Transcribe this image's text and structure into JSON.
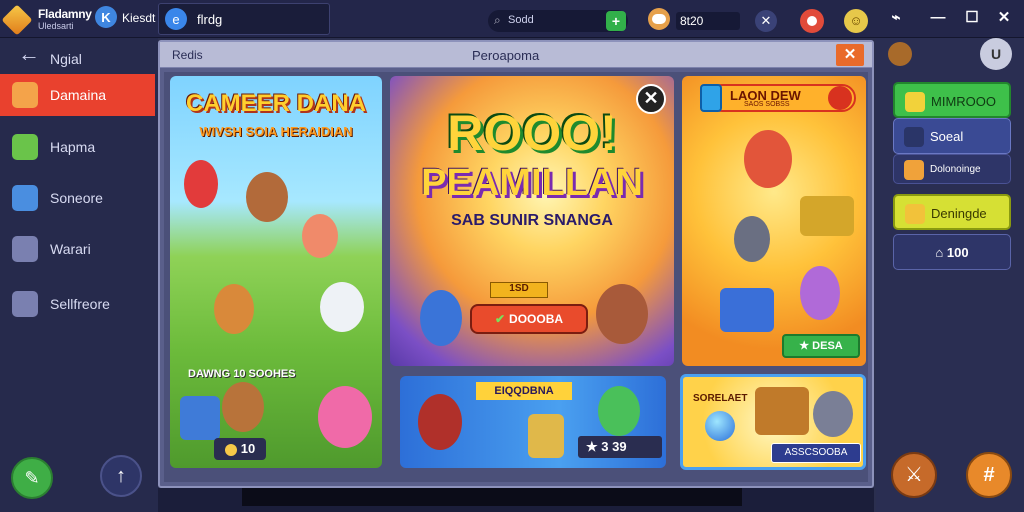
{
  "topbar": {
    "brand_title": "Fladamny",
    "brand_sub": "Uledsarti",
    "brand2_letter": "K",
    "brand2_text": "Kiesdt",
    "search_value": "flrdg",
    "pill_text": "Sodd",
    "pill_plus": "+",
    "coins": "8t20",
    "close": "✕",
    "win_min": "—",
    "win_max": "☐",
    "win_close": "✕"
  },
  "sidebar": {
    "back_label": "Ngial",
    "items": [
      {
        "label": "Damaina",
        "active": true,
        "icon": "box-icon",
        "color": "#f4a34a"
      },
      {
        "label": "Hapma",
        "active": false,
        "icon": "cubes-icon",
        "color": "#6ac44a"
      },
      {
        "label": "Soneore",
        "active": false,
        "icon": "window-icon",
        "color": "#4a8ee0"
      },
      {
        "label": "Warari",
        "active": false,
        "icon": "stack-icon",
        "color": "#7a80b0"
      },
      {
        "label": "Sellfreore",
        "active": false,
        "icon": "page-icon",
        "color": "#7a80b0"
      }
    ]
  },
  "modal": {
    "header_left": "Redis",
    "header_title": "Peroapoma",
    "close": "✕",
    "card1": {
      "title": "CAMEER DANA",
      "subtitle": "WIVSH SOIA HERAIDIAN",
      "label": "DAWNG 10 SOOHES",
      "badge_value": "10"
    },
    "card2": {
      "title1": "ROOO!",
      "title2": "PEAMILLAN",
      "subtitle": "SAB SUNIR SNANGA",
      "gold_label": "1SD",
      "button": "DOOOBA",
      "close": "✕"
    },
    "card3": {
      "header": "LAON DEW",
      "header_sub": "SAOS SOBSS",
      "button": "DESA"
    },
    "card4": {
      "label": "EIQQDBNA",
      "score": "3 39"
    },
    "card5": {
      "label": "SORELAET",
      "bar": "ASSCSOOBA"
    }
  },
  "right_panel": {
    "lock": "U",
    "buttons": [
      {
        "label": "MIMROOO"
      },
      {
        "label": "Soeal"
      },
      {
        "label": "Dolonoinge"
      },
      {
        "label": "Deningde"
      },
      {
        "label": "100"
      }
    ]
  },
  "colors": {
    "accent": "#e9412e",
    "panel": "#262a4c",
    "green": "#3ec04a",
    "yellow": "#d6e034"
  }
}
